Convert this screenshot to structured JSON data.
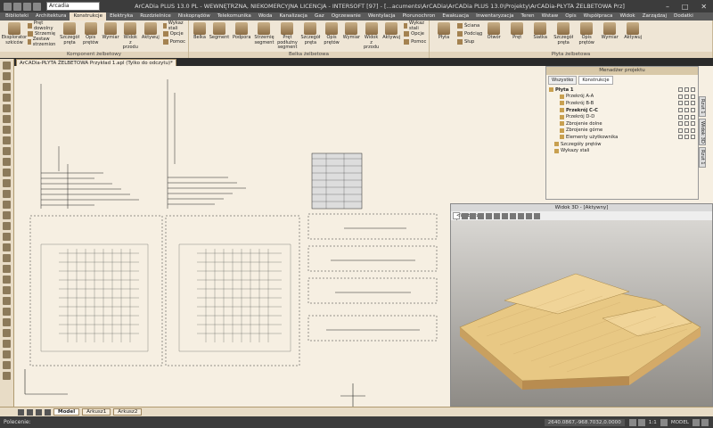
{
  "titlebar": {
    "combo": "Arcadia",
    "title": "ArCADia PLUS 13.0 PL - WEWNĘTRZNA, NIEKOMERCYJNA LICENCJA - INTERSOFT [97] - [...acuments\\ArCADia\\ArCADia PLUS 13.0\\Projekty\\ArCADia-PŁYTA ŻELBETOWA Prz]"
  },
  "menu": {
    "tabs": [
      "Biblioteki",
      "Architektura",
      "Konstrukcje",
      "Elektryka",
      "Rozdzielnice",
      "Niskoprądów",
      "Telekomunika",
      "Woda",
      "Kanalizacja",
      "Gaz",
      "Ogrzewanie",
      "Wentylacja",
      "Piorunochron",
      "Ewakuacja",
      "Inwentaryzacja",
      "Teren",
      "Wstaw",
      "Opis",
      "Współpraca",
      "Widok",
      "Zarządzaj",
      "Dodatki"
    ],
    "active": "Konstrukcje"
  },
  "ribbon": {
    "groups": [
      {
        "name": "Komponent żelbetowy",
        "buttons": [
          "Eksplorator szkiców"
        ],
        "small": [
          "Pręt dowolny",
          "Strzemię",
          "Zestaw strzemion"
        ],
        "buttons2": [
          "Szczegół pręta",
          "Opis prętów",
          "Wymiar",
          "Widok z przodu",
          "Aktywuj"
        ],
        "small2": [
          "Wykaz stali",
          "Opcje",
          "Pomoc"
        ]
      },
      {
        "name": "Belka żelbetowa",
        "buttons": [
          "Belka",
          "Segment",
          "Podpora",
          "Strzemię segment",
          "Pręt podłużny segment",
          "Szczegół pręta",
          "Opis prętów",
          "Wymiar",
          "Widok z przodu",
          "Aktywuj"
        ],
        "small": [
          "Wykaz stali",
          "Opcje",
          "Pomoc"
        ]
      },
      {
        "name": "Płyta żelbetowa",
        "buttons": [
          "Płyta"
        ],
        "small": [
          "Ściana",
          "Podciąg",
          "Słup"
        ],
        "buttons2": [
          "Otwór",
          "Pręt",
          "Siatka",
          "Szczegół pręta",
          "Opis prętów",
          "Wymiar",
          "Aktywuj"
        ]
      }
    ]
  },
  "document_tab": "ArCADia-PŁYTA ŻELBETOWA Przykład 1.apl (Tylko do odczytu)*",
  "project_manager": {
    "title": "Menadżer projektu",
    "tabs": [
      "Wszystko",
      "Konstrukcje"
    ],
    "active_tab": "Konstrukcje",
    "tree": [
      "Płyta 1",
      "Przekrój A-A",
      "Przekrój B-B",
      "Przekrój C-C",
      "Przekrój D-D",
      "Zbrojenie dolne",
      "Zbrojenie górne",
      "Elementy użytkownika",
      "Szczegóły prętów",
      "Wykazy stali"
    ]
  },
  "side_tabs": [
    "Rzut 1",
    "Widok 3D",
    "Rzut 1"
  ],
  "view3d": {
    "title": "Widok 3D - [Aktywny]",
    "camera": "<Wybierz kamerę>"
  },
  "bottom_tabs": [
    "Model",
    "Arkusz1",
    "Arkusz2"
  ],
  "active_bottom_tab": "Model",
  "status": {
    "command": "Polecenie:",
    "coords": "2640.0867,-968.7032,0.0000",
    "scale": "1:1",
    "mode": "MODEL"
  },
  "colors": {
    "ribbon": "#efe6d6",
    "canvas": "#f6efe2",
    "accent": "#a08860"
  }
}
